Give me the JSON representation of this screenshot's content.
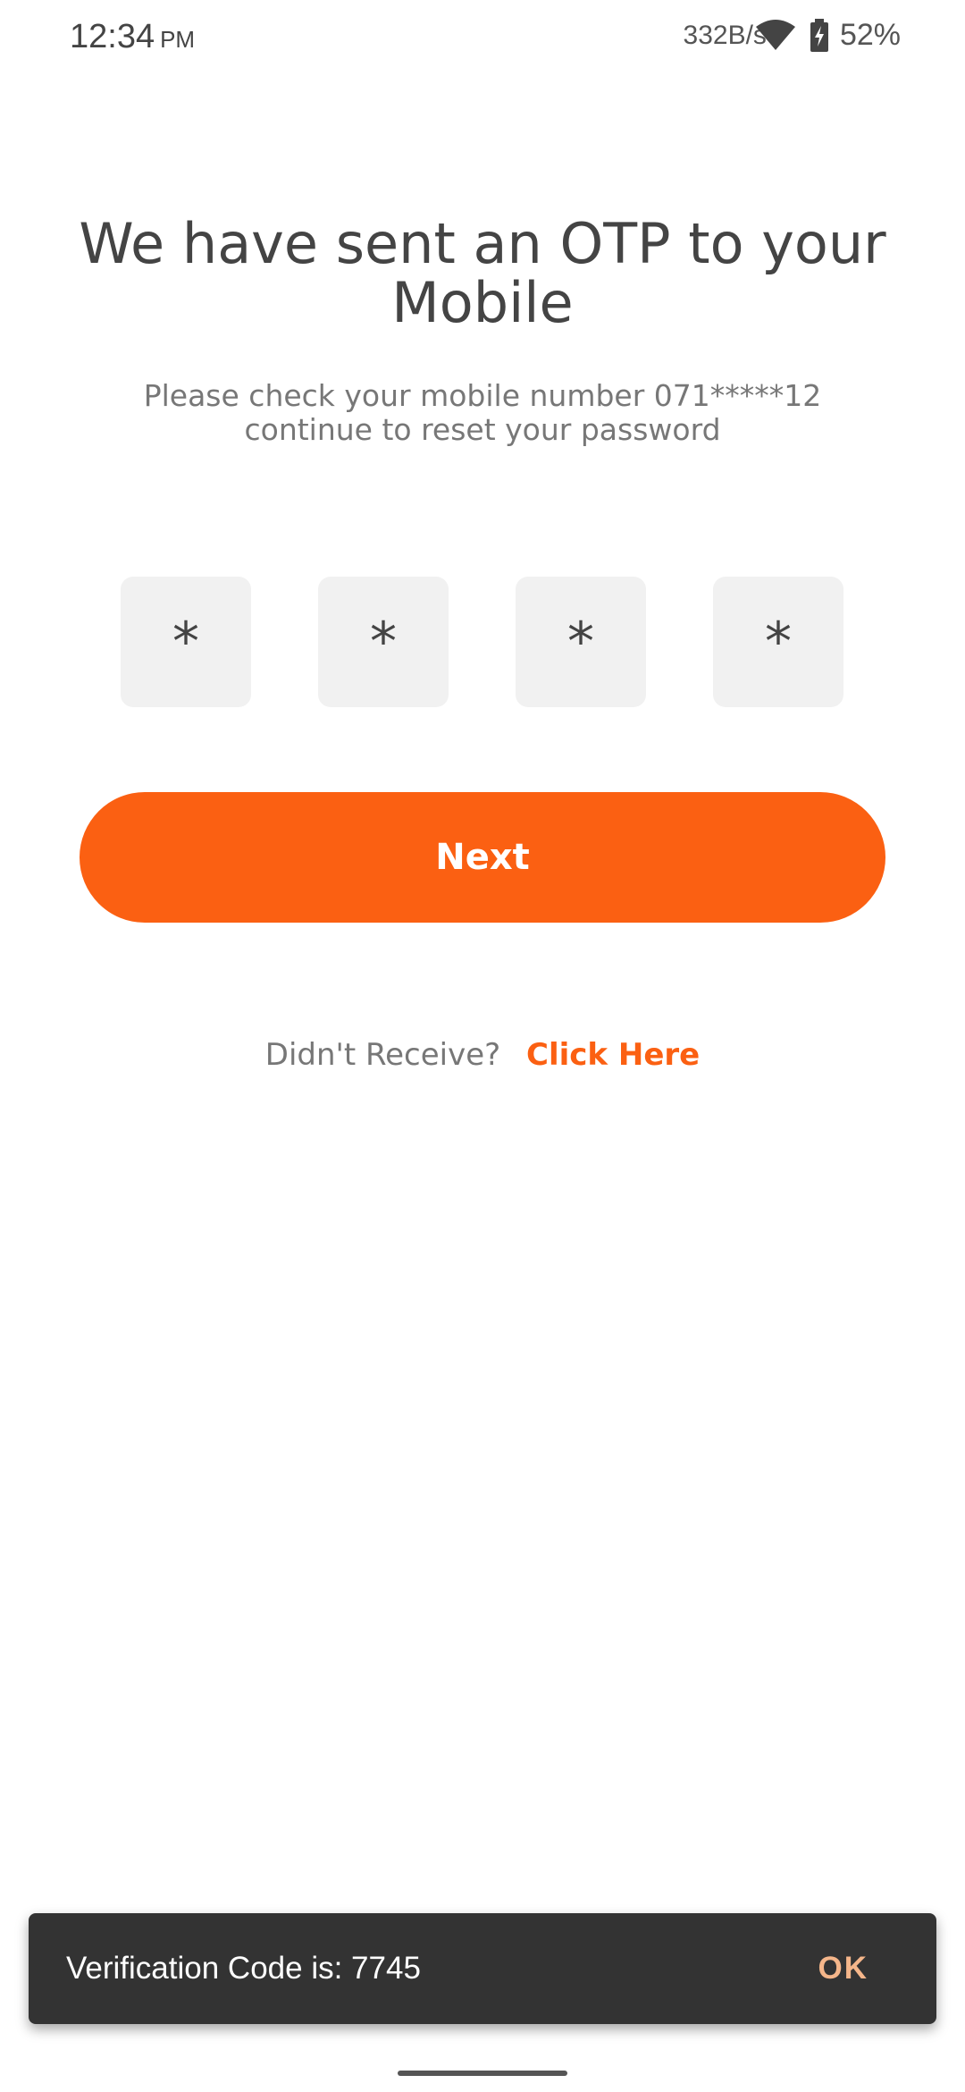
{
  "status_bar": {
    "time": "12:34",
    "ampm": "PM",
    "network_speed": "332B/s",
    "battery": "52%"
  },
  "header": {
    "title": "We have sent an OTP to your Mobile",
    "subtitle": "Please check your mobile number 071*****12 continue to reset your password"
  },
  "otp": {
    "digits": [
      "*",
      "*",
      "*",
      "*"
    ]
  },
  "actions": {
    "next_label": "Next",
    "resend_prompt": "Didn't Receive?",
    "resend_link": "Click Here"
  },
  "snackbar": {
    "message": "Verification Code is: 7745",
    "action": "OK"
  },
  "colors": {
    "accent": "#fb6012",
    "snackbar_bg": "#333333",
    "snackbar_action": "#f5b68a",
    "otp_box_bg": "#f1f1f1"
  },
  "icons": [
    "wifi-icon",
    "battery-charging-icon"
  ]
}
